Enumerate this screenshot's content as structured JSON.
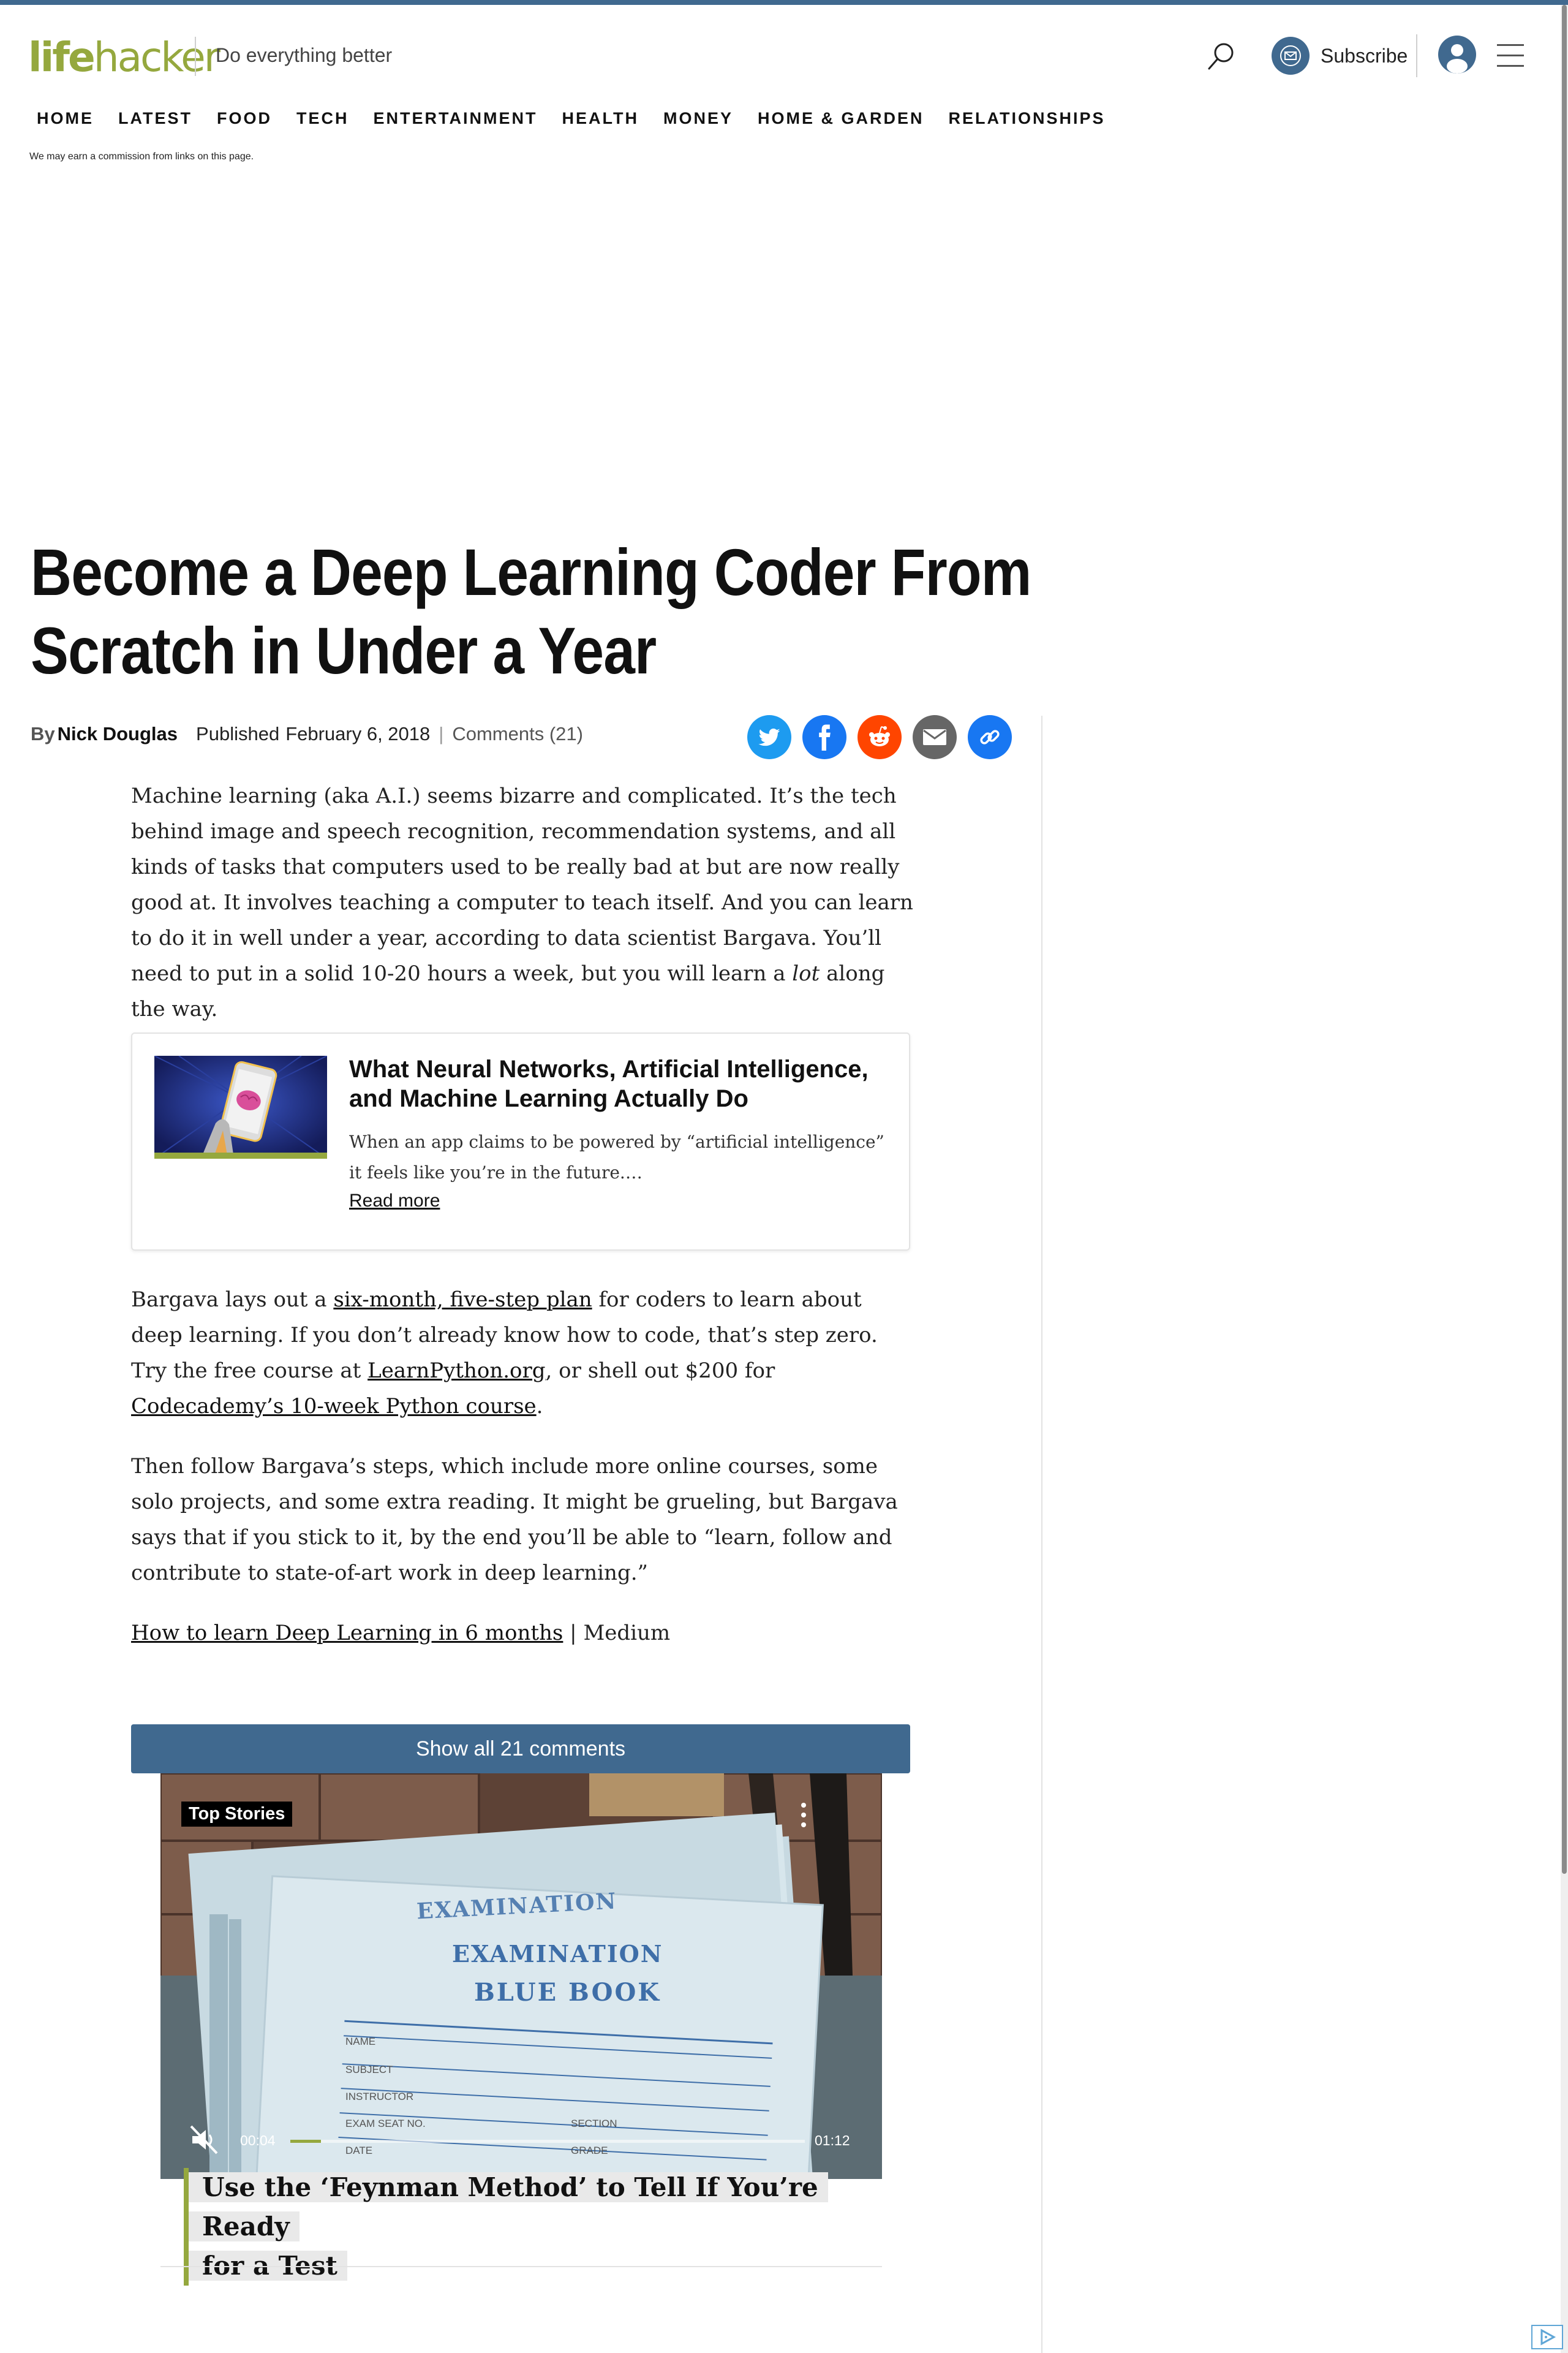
{
  "site": {
    "logo_part1": "life",
    "logo_part2": "hacker",
    "tagline": "Do everything better",
    "subscribe_label": "Subscribe",
    "brand_color": "#95a83e",
    "accent_color": "#40698f"
  },
  "header_icons": [
    "search-icon",
    "mail-icon",
    "account-icon",
    "hamburger-menu-icon"
  ],
  "nav": [
    "HOME",
    "LATEST",
    "FOOD",
    "TECH",
    "ENTERTAINMENT",
    "HEALTH",
    "MONEY",
    "HOME & GARDEN",
    "RELATIONSHIPS"
  ],
  "disclaimer": "We may earn a commission from links on this page.",
  "article": {
    "title": "Become a Deep Learning Coder From Scratch in Under a Year",
    "by_label": "By",
    "author": "Nick Douglas",
    "published_label": "Published",
    "published_date": "February 6, 2018",
    "separator": "|",
    "comments_link": "Comments (21)",
    "share_icons": [
      "twitter-icon",
      "facebook-icon",
      "reddit-icon",
      "email-icon",
      "link-icon"
    ],
    "share_colors": {
      "twitter": "#1d9bf0",
      "facebook": "#1877f2",
      "reddit": "#ff4500",
      "email": "#666666",
      "link": "#1877f2"
    },
    "p1_a": "Machine learning (aka A.I.) seems bizarre and complicated. It’s the tech behind image and speech recognition, recommendation systems, and all kinds of tasks that computers used to be really bad at but are now really good at. It involves teaching a computer to teach itself. And you can learn to do it in well under a year, according to data scientist Bargava. You’ll need to put in a solid 10-20 hours a week, but you will learn a ",
    "p1_em": "lot",
    "p1_b": " along the way.",
    "related": {
      "title": "What Neural Networks, Artificial Intelligence, and Machine Learning Actually Do",
      "description": "When an app claims to be powered by “artificial intelligence” it feels like you’re in the future.…",
      "read_more": "Read more"
    },
    "p2_a": "Bargava lays out a ",
    "p2_link1": "six-month, five-step plan",
    "p2_b": " for coders to learn about deep learning. If you don’t already know how to code, that’s step zero. Try the free course at ",
    "p2_link2": "LearnPython.org",
    "p2_c": ", or shell out $200 for ",
    "p2_link3": "Codecademy’s 10-week Python course",
    "p2_d": ".",
    "p3": "Then follow Bargava’s steps, which include more online courses, some solo projects, and some extra reading. It might be grueling, but Bargava says that if you stick to it, by the end you’ll be able to “learn, follow and contribute to state-of-art work in deep learning.”",
    "source_link": "How to learn Deep Learning in 6 months",
    "source_suffix": " | Medium",
    "show_comments": "Show all 21 comments"
  },
  "video": {
    "badge": "Top Stories",
    "paper_line1": "EXAMINATION",
    "paper_line2": "EXAMINATION",
    "paper_line3": "BLUE BOOK",
    "form_fields": [
      "NAME",
      "SUBJECT",
      "INSTRUCTOR",
      "EXAM SEAT NO.",
      "SECTION",
      "DATE",
      "GRADE"
    ],
    "time_current": "00:04",
    "time_total": "01:12",
    "progress_fraction": 0.06,
    "caption_line1": "Use the ‘Feynman Method’ to Tell If You’re Ready",
    "caption_line2": "for a Test"
  }
}
